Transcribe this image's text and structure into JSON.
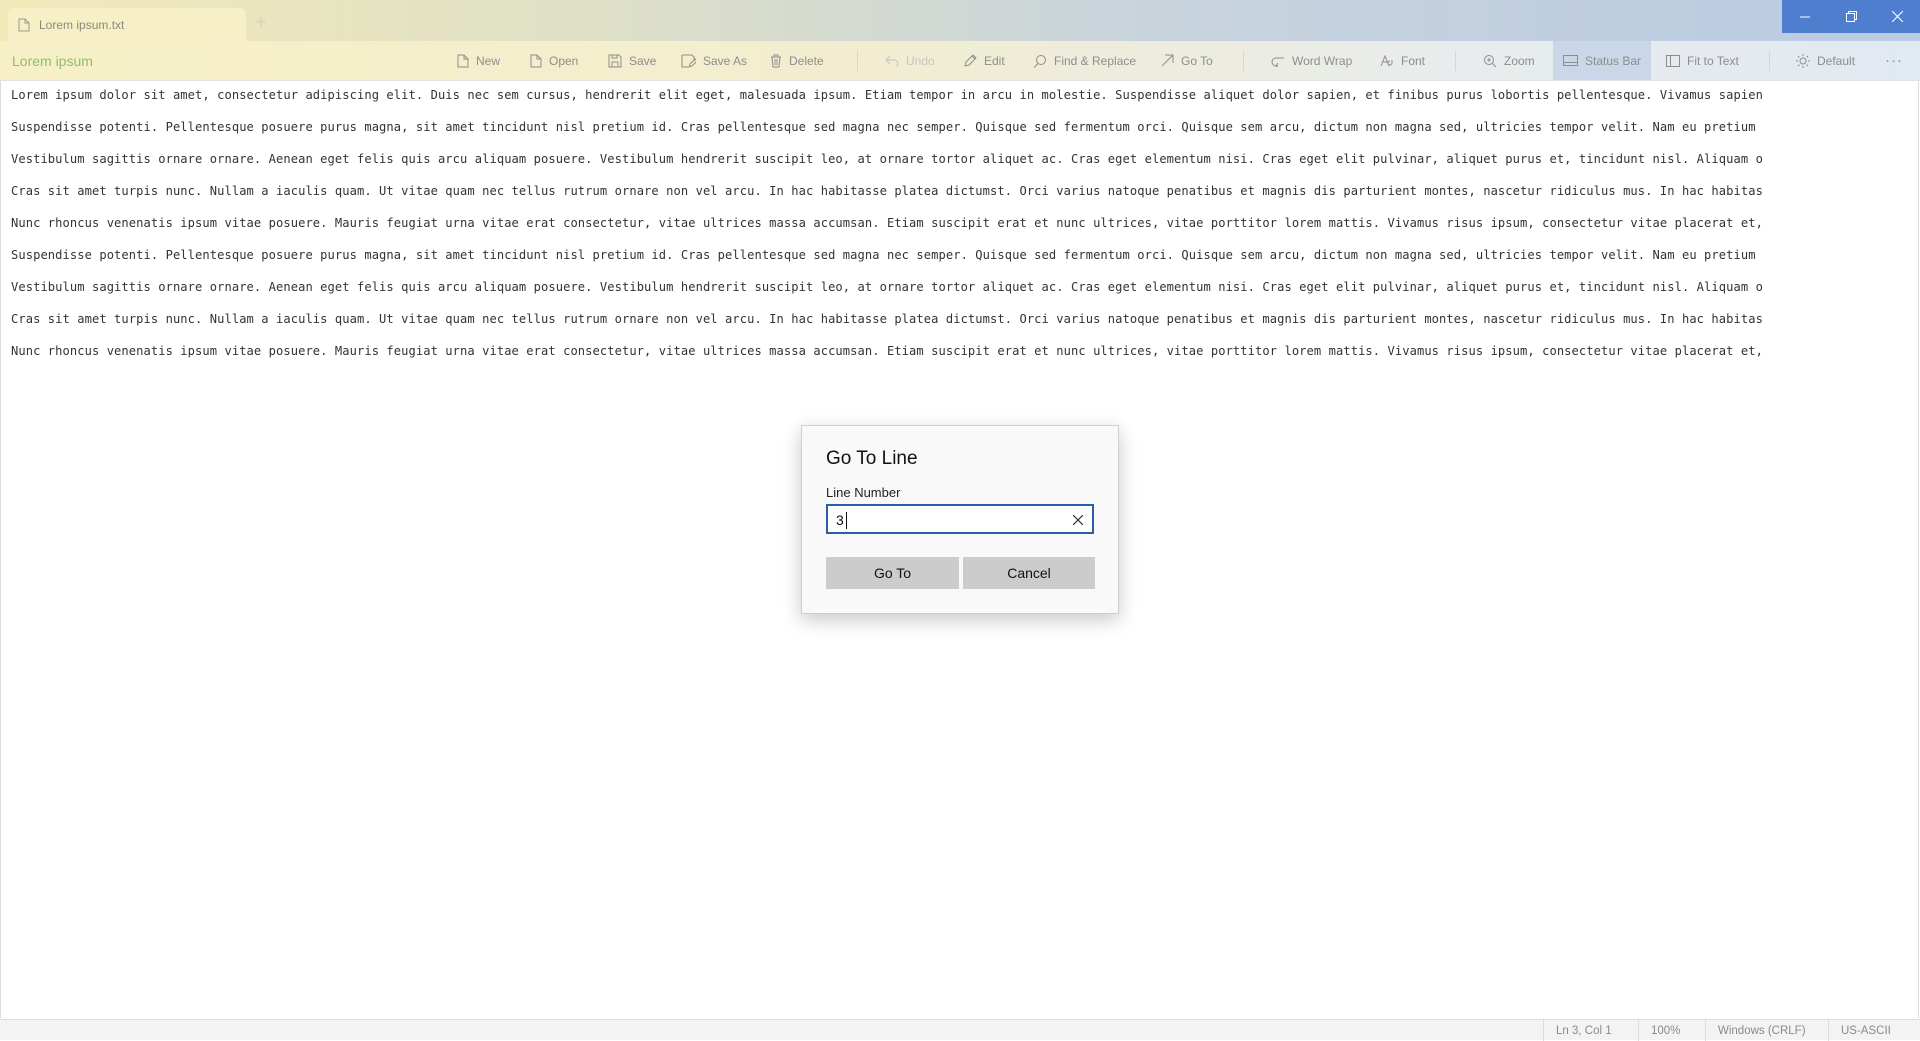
{
  "tab": {
    "title": "Lorem ipsum.txt",
    "new_tab_symbol": "+"
  },
  "app": {
    "name": "Lorem ipsum"
  },
  "toolbar": {
    "new": "New",
    "open": "Open",
    "save": "Save",
    "save_as": "Save As",
    "delete": "Delete",
    "undo": "Undo",
    "edit": "Edit",
    "find_replace": "Find & Replace",
    "go_to": "Go To",
    "word_wrap": "Word Wrap",
    "font": "Font",
    "zoom": "Zoom",
    "status_bar": "Status Bar",
    "fit_to_text": "Fit to Text",
    "theme": "Default",
    "more": "···"
  },
  "editor": {
    "lines": [
      "Lorem ipsum dolor sit amet, consectetur adipiscing elit. Duis nec sem cursus, hendrerit elit eget, malesuada ipsum. Etiam tempor in arcu in molestie. Suspendisse aliquet dolor sapien, et finibus purus lobortis pellentesque. Vivamus sapien",
      "Suspendisse potenti. Pellentesque posuere purus magna, sit amet tincidunt nisl pretium id. Cras pellentesque sed magna nec semper. Quisque sed fermentum orci. Quisque sem arcu, dictum non magna sed, ultricies tempor velit. Nam eu pretium",
      "Vestibulum sagittis ornare ornare. Aenean eget felis quis arcu aliquam posuere. Vestibulum hendrerit suscipit leo, at ornare tortor aliquet ac. Cras eget elementum nisi. Cras eget elit pulvinar, aliquet purus et, tincidunt nisl. Aliquam o",
      "Cras sit amet turpis nunc. Nullam a iaculis quam. Ut vitae quam nec tellus rutrum ornare non vel arcu. In hac habitasse platea dictumst. Orci varius natoque penatibus et magnis dis parturient montes, nascetur ridiculus mus. In hac habitas",
      "Nunc rhoncus venenatis ipsum vitae posuere. Mauris feugiat urna vitae erat consectetur, vitae ultrices massa accumsan. Etiam suscipit erat et nunc ultrices, vitae porttitor lorem mattis. Vivamus risus ipsum, consectetur vitae placerat et,",
      "Suspendisse potenti. Pellentesque posuere purus magna, sit amet tincidunt nisl pretium id. Cras pellentesque sed magna nec semper. Quisque sed fermentum orci. Quisque sem arcu, dictum non magna sed, ultricies tempor velit. Nam eu pretium",
      "Vestibulum sagittis ornare ornare. Aenean eget felis quis arcu aliquam posuere. Vestibulum hendrerit suscipit leo, at ornare tortor aliquet ac. Cras eget elementum nisi. Cras eget elit pulvinar, aliquet purus et, tincidunt nisl. Aliquam o",
      "Cras sit amet turpis nunc. Nullam a iaculis quam. Ut vitae quam nec tellus rutrum ornare non vel arcu. In hac habitasse platea dictumst. Orci varius natoque penatibus et magnis dis parturient montes, nascetur ridiculus mus. In hac habitas",
      "Nunc rhoncus venenatis ipsum vitae posuere. Mauris feugiat urna vitae erat consectetur, vitae ultrices massa accumsan. Etiam suscipit erat et nunc ultrices, vitae porttitor lorem mattis. Vivamus risus ipsum, consectetur vitae placerat et,"
    ]
  },
  "dialog": {
    "title": "Go To Line",
    "field_label": "Line Number",
    "field_value": "3",
    "goto_label": "Go To",
    "cancel_label": "Cancel"
  },
  "status": {
    "position": "Ln 3, Col 1",
    "zoom": "100%",
    "line_ending": "Windows (CRLF)",
    "encoding": "US-ASCII"
  },
  "colors": {
    "accent": "#4f7ecf",
    "app_name": "#8fbf6a",
    "field_border": "#2b5fa8"
  }
}
